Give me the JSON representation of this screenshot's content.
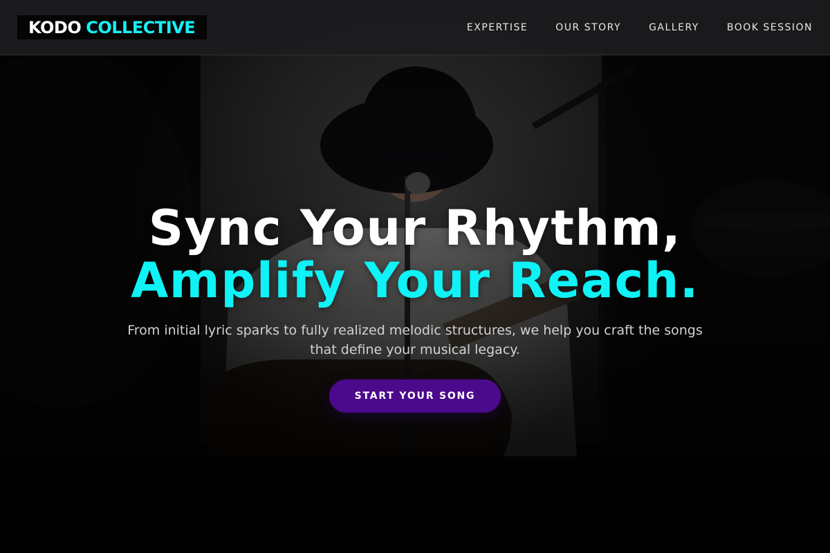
{
  "brand": {
    "name_part1": "KODO",
    "name_part2": "COLLECTIVE",
    "accent_color": "#14f1f5"
  },
  "nav": {
    "items": [
      {
        "label": "EXPERTISE"
      },
      {
        "label": "OUR STORY"
      },
      {
        "label": "GALLERY"
      },
      {
        "label": "BOOK SESSION"
      }
    ]
  },
  "hero": {
    "headline_line1": "Sync Your Rhythm,",
    "headline_line2": "Amplify Your Reach.",
    "subtext": "From initial lyric sparks to fully realized melodic structures, we help you craft the songs that define your musical legacy.",
    "cta_label": "START YOUR SONG",
    "cta_color": "#4b0a8c",
    "background_image": "singer-with-guitar-and-microphone-photo"
  }
}
